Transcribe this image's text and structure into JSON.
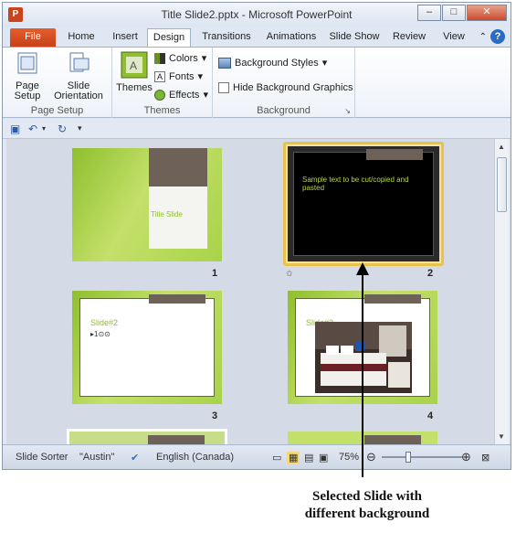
{
  "window": {
    "title": "Title Slide2.pptx - Microsoft PowerPoint",
    "app_icon": "P"
  },
  "window_controls": {
    "minimize": "–",
    "maximize": "□",
    "close": "✕"
  },
  "tabs": [
    {
      "label": "File"
    },
    {
      "label": "Home"
    },
    {
      "label": "Insert"
    },
    {
      "label": "Design"
    },
    {
      "label": "Transitions"
    },
    {
      "label": "Animations"
    },
    {
      "label": "Slide Show"
    },
    {
      "label": "Review"
    },
    {
      "label": "View"
    }
  ],
  "ribbon": {
    "page_setup": {
      "page_setup_label": "Page Setup",
      "orientation_label": "Slide Orientation",
      "group_label": "Page Setup"
    },
    "themes": {
      "themes_label": "Themes",
      "colors": "Colors",
      "fonts": "Fonts",
      "effects": "Effects",
      "group_label": "Themes"
    },
    "background": {
      "styles": "Background Styles",
      "hide": "Hide Background Graphics",
      "group_label": "Background"
    }
  },
  "slides": [
    {
      "number": "1",
      "title": "Title Slide"
    },
    {
      "number": "2",
      "text": "Sample text to be cut/copied and pasted"
    },
    {
      "number": "3",
      "title": "Slide#2",
      "bullet": "▸1⊙⊙"
    },
    {
      "number": "4",
      "title": "Slide#3"
    }
  ],
  "status_bar": {
    "view": "Slide Sorter",
    "theme": "\"Austin\"",
    "language": "English (Canada)",
    "zoom": "75%"
  },
  "caption": {
    "line1": "Selected Slide with",
    "line2": "different background"
  }
}
